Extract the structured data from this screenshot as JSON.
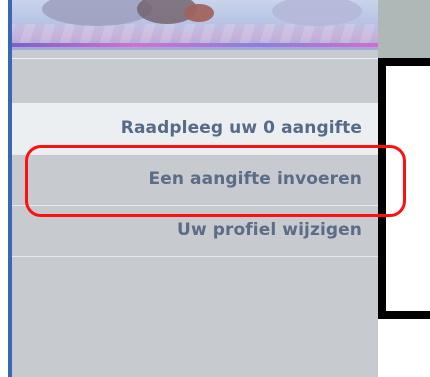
{
  "sidebar": {
    "items": [
      {
        "label": "Raadpleeg uw 0 aangifte"
      },
      {
        "label": "Een aangifte invoeren"
      },
      {
        "label": "Uw profiel wijzigen"
      }
    ]
  },
  "highlight": {
    "target": "Een aangifte invoeren",
    "color": "#ff1010"
  },
  "theme": {
    "sidebar_background": "#c7cbcf",
    "active_background": "#eceff2",
    "label_color": "#5a6c86",
    "frame_color": "#000000",
    "edge_blue": "#3a66b6"
  },
  "icons": {
    "banner": "banner-image"
  }
}
